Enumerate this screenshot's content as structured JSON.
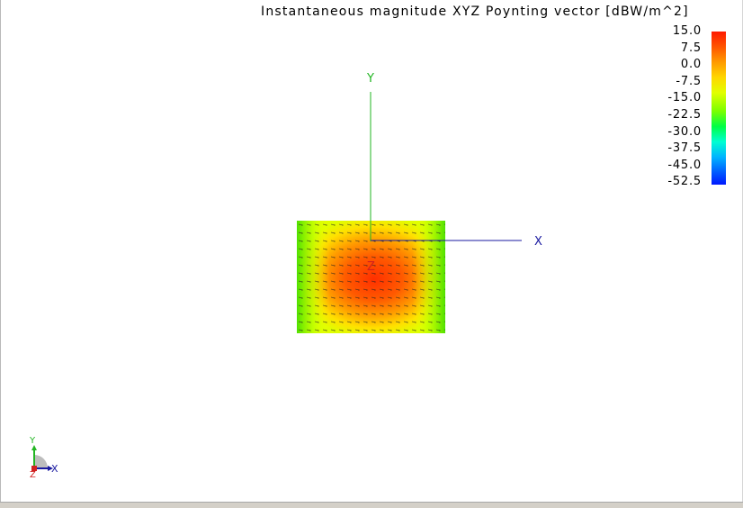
{
  "viewport": {
    "title": "Instantaneous magnitude XYZ Poynting vector [dBW/m^2]",
    "legend": {
      "ticks": [
        "15.0",
        "7.5",
        "0.0",
        "-7.5",
        "-15.0",
        "-22.5",
        "-30.0",
        "-37.5",
        "-45.0",
        "-52.5"
      ],
      "max": 15.0,
      "min": -52.5
    },
    "axes": {
      "x_label": "X",
      "y_label": "Y",
      "z_label": "Z",
      "x_color": "#1a1aa0",
      "y_color": "#22b522",
      "z_color": "#d02020"
    },
    "triad": {
      "x_label": "X",
      "y_label": "Y",
      "z_label": "Z"
    }
  }
}
